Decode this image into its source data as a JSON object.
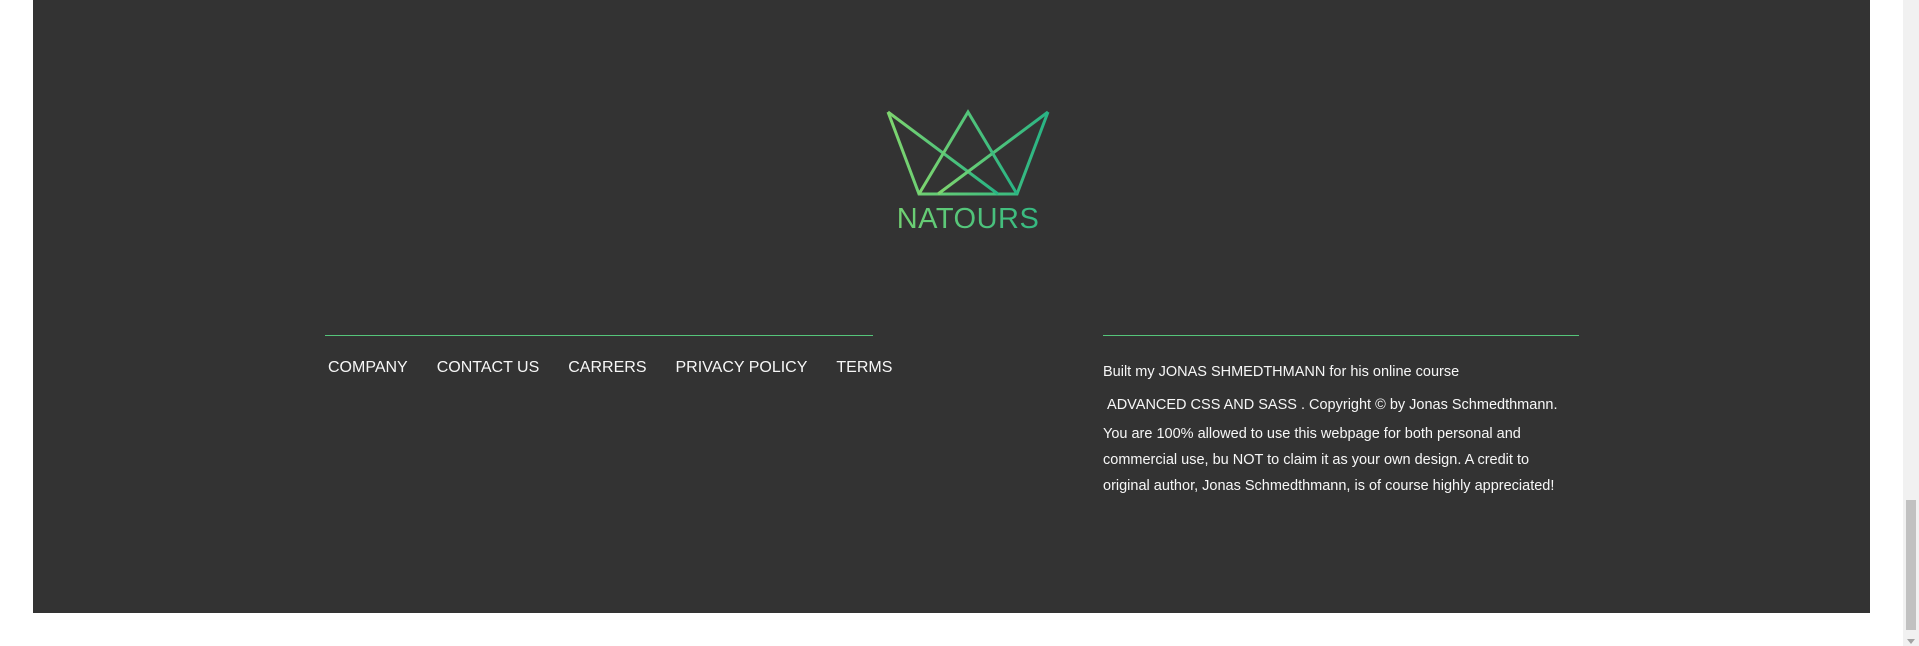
{
  "footer": {
    "logo": {
      "icon": "crown-icon",
      "text": "NATOURS",
      "gradient_start": "#7ed56f",
      "gradient_end": "#28b485"
    },
    "nav": {
      "items": [
        {
          "label": "COMPANY"
        },
        {
          "label": "CONTACT US"
        },
        {
          "label": "CARRERS"
        },
        {
          "label": "PRIVACY POLICY"
        },
        {
          "label": "TERMS"
        }
      ]
    },
    "copyright": {
      "line1_prefix": "Built my ",
      "author_link": "JONAS SHMEDTHMANN",
      "line1_suffix": " for his online course",
      "course_link": "ADVANCED CSS AND SASS",
      "line2_suffix": ". Copyright © by Jonas Schmedthmann.",
      "paragraph": "You are 100% allowed to use this webpage for both personal and commercial use, bu NOT to claim it as your own design. A credit to original author, Jonas Schmedthmann, is of course highly appreciated!"
    },
    "colors": {
      "background": "#333333",
      "text": "#f7f7f7",
      "accent": "#55c57a"
    }
  }
}
